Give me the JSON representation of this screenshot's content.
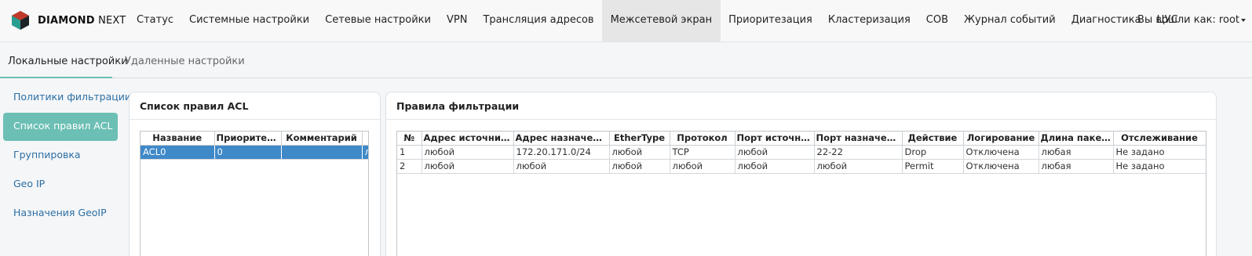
{
  "brand": {
    "name_bold": "DIAMOND",
    "name_light": " NEXT"
  },
  "nav": {
    "items": [
      {
        "label": "Статус"
      },
      {
        "label": "Системные настройки"
      },
      {
        "label": "Сетевые настройки"
      },
      {
        "label": "VPN"
      },
      {
        "label": "Трансляция адресов"
      },
      {
        "label": "Межсетевой экран",
        "active": true
      },
      {
        "label": "Приоритезация"
      },
      {
        "label": "Кластеризация"
      },
      {
        "label": "СОВ"
      },
      {
        "label": "Журнал событий"
      },
      {
        "label": "Диагностика"
      },
      {
        "label": "ЦУС"
      }
    ],
    "user_label": "Вы вошли как: root"
  },
  "subtabs": {
    "local": "Локальные настройки",
    "remote": "Удаленные настройки"
  },
  "sidebar": {
    "items": [
      {
        "label": "Политики фильтрации"
      },
      {
        "label": "Список правил ACL",
        "active": true
      },
      {
        "label": "Группировка"
      },
      {
        "label": "Geo IP"
      },
      {
        "label": "Назначения GeoIP"
      }
    ]
  },
  "acl_panel": {
    "title": "Список правил ACL",
    "columns": [
      "Название",
      "Приоритет...",
      "Комментарий"
    ],
    "rows": [
      {
        "name": "ACL0",
        "priority": "0",
        "comment": "",
        "extra": "л"
      }
    ]
  },
  "rules_panel": {
    "title": "Правила фильтрации",
    "columns": [
      "№",
      "Адрес источника",
      "Адрес назначения",
      "EtherType",
      "Протокол",
      "Порт источника",
      "Порт назначения",
      "Действие",
      "Логирование",
      "Длина пакета",
      "Отслеживание"
    ],
    "rows": [
      [
        "1",
        "любой",
        "172.20.171.0/24",
        "любой",
        "TCP",
        "любой",
        "22-22",
        "Drop",
        "Отключена",
        "любая",
        "Не задано"
      ],
      [
        "2",
        "любой",
        "любой",
        "любой",
        "любой",
        "любой",
        "любой",
        "Permit",
        "Отключена",
        "любая",
        "Не задано"
      ]
    ]
  },
  "colors": {
    "accent": "#6cbfb4",
    "selection": "#3f89c9",
    "link": "#2d6ea3"
  }
}
